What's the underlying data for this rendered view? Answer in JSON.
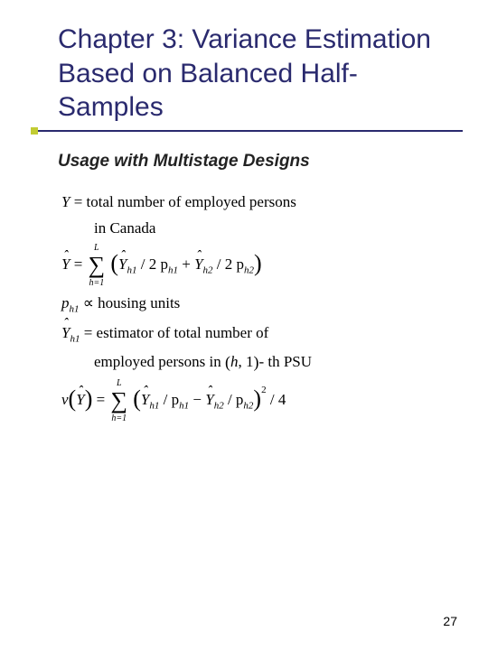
{
  "title": "Chapter 3: Variance Estimation Based on Balanced Half-Samples",
  "subtitle": "Usage with Multistage Designs",
  "math": {
    "line1_prefix": "Y",
    "line1_eq": " =   total number of employed persons",
    "line1_cont": "in Canada",
    "sum_upper": "L",
    "sum_lower": "h=1",
    "line2_lhs": "Ŷ",
    "line2_inside_a": " / 2 p",
    "line2_inside_b": " + ",
    "line2_inside_c": " / 2 p",
    "line3_pre": "p",
    "line3_rest": " ∝ housing units",
    "line4_rest": " = estimator of total number of",
    "line4_cont": "employed persons in (h, 1) - th PSU",
    "line5_pre": "v",
    "line5_inside_a": " / p",
    "line5_inside_b": " − ",
    "line5_inside_c": " / p",
    "line5_tail": " / 4",
    "sub_h1": "h1",
    "sub_h2": "h2"
  },
  "pagenum": "27"
}
